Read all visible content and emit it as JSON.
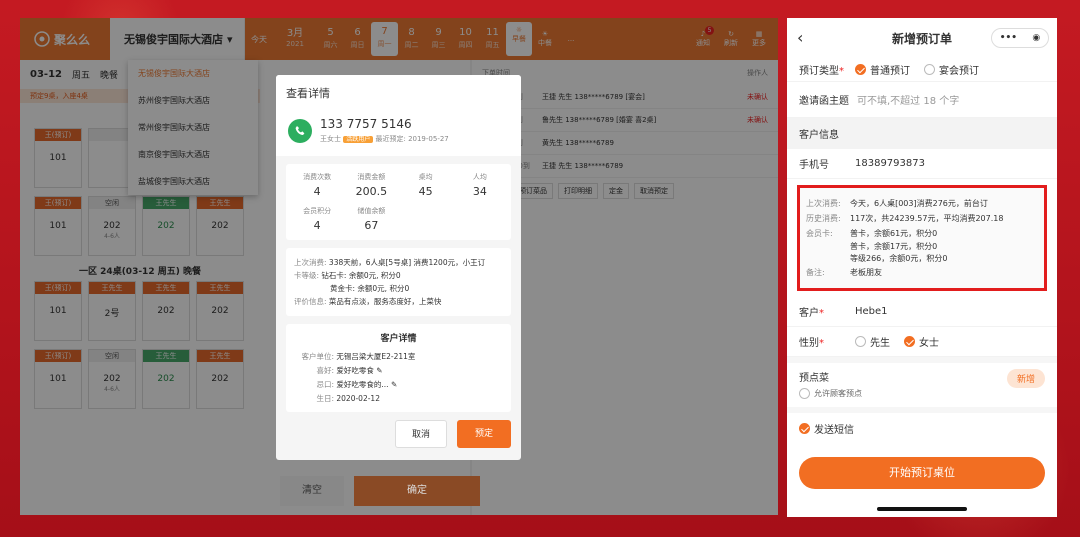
{
  "left": {
    "logo": "聚么么",
    "hotel": "无锡俊宇国际大酒店",
    "today": "今天",
    "month": {
      "label": "3月",
      "year": "2021"
    },
    "days": [
      {
        "d": "5",
        "w": "周六"
      },
      {
        "d": "6",
        "w": "周日"
      },
      {
        "d": "7",
        "w": "周一"
      },
      {
        "d": "8",
        "w": "周二"
      },
      {
        "d": "9",
        "w": "周三"
      },
      {
        "d": "10",
        "w": "周四"
      },
      {
        "d": "11",
        "w": "周五"
      }
    ],
    "meals": [
      "早餐",
      "中餐"
    ],
    "more": "...",
    "top_right": [
      {
        "t": "通知",
        "b": "5"
      },
      {
        "t": "刷新"
      },
      {
        "t": "更多"
      }
    ],
    "date": "03-12",
    "date_sub": "周五",
    "date_tab": "晚餐",
    "warn": "预定9桌，入座4桌",
    "area1": "一区",
    "area2": "一区 24桌(03-12 周五) 晚餐",
    "tables": [
      [
        {
          "h": "王(预订)",
          "n": "101",
          "c": "o"
        },
        {
          "h": "",
          "n": "",
          "c": "w"
        },
        {
          "h": "",
          "n": "",
          "c": "w"
        },
        {
          "h": "王先生",
          "n": "",
          "c": "o"
        }
      ],
      [
        {
          "h": "王(预订)",
          "n": "101",
          "c": "o"
        },
        {
          "h": "空闲",
          "n": "202",
          "s": "4-6人",
          "c": "w"
        },
        {
          "h": "王先生",
          "n": "202",
          "c": "g"
        },
        {
          "h": "王先生",
          "n": "202",
          "c": "o"
        }
      ],
      [
        {
          "h": "王(预订)",
          "n": "101",
          "c": "o"
        },
        {
          "h": "王先生",
          "n": "2号",
          "c": "o"
        },
        {
          "h": "王先生",
          "n": "202",
          "c": "o"
        },
        {
          "h": "王先生",
          "n": "202",
          "c": "o"
        }
      ],
      [
        {
          "h": "王(预订)",
          "n": "101",
          "c": "o"
        },
        {
          "h": "空闲",
          "n": "202",
          "s": "4-6人",
          "c": "w"
        },
        {
          "h": "王先生",
          "n": "202",
          "c": "g"
        },
        {
          "h": "王先生",
          "n": "202",
          "c": "o"
        }
      ]
    ],
    "dropdown": [
      "无锡俊宇国际大酒店",
      "苏州俊宇国际大酒店",
      "常州俊宇国际大酒店",
      "南京俊宇国际大酒店",
      "盐城俊宇国际大酒店"
    ],
    "rp_head": [
      "下单时间",
      "操作人"
    ],
    "reservations": [
      {
        "tm": "7人 18:00到",
        "nm": "王捷 先生 138*****6789 [宴会]",
        "st": "未确认"
      },
      {
        "tm": "8人 18:00到",
        "nm": "鲁先生 138*****6789 [婚宴 喜2桌]",
        "st": "未确认"
      },
      {
        "tm": "5人 18:00到",
        "nm": "黄先生 138*****6789",
        "st": ""
      },
      {
        "tm": "3-5人 18:00到",
        "nm": "王捷 先生 138*****6789",
        "st": ""
      }
    ],
    "actions": [
      "修改",
      "预订菜品",
      "打印明细",
      "定金",
      "取消预定"
    ],
    "clear": "清空",
    "confirm": "确定"
  },
  "modal": {
    "title": "查看详情",
    "phone": "133 7757 5146",
    "name": "王女士",
    "vip": "活跃用户",
    "last": "最近预定: 2019-05-27",
    "stats": [
      {
        "l": "消费次数",
        "v": "4"
      },
      {
        "l": "消费金额",
        "v": "200.5"
      },
      {
        "l": "桌均",
        "v": "45"
      },
      {
        "l": "人均",
        "v": "34"
      },
      {
        "l": "会员积分",
        "v": "4"
      },
      {
        "l": "储值余额",
        "v": "67"
      }
    ],
    "info": [
      {
        "l": "上次消费:",
        "v": "338天前，6人桌[5号桌] 消费1200元，小王订"
      },
      {
        "l": "卡等级:",
        "v": "钻石卡: 余额0元, 积分0"
      },
      {
        "l": "",
        "v": "黄金卡: 余额0元, 积分0"
      },
      {
        "l": "评价信息:",
        "v": "菜品有点淡，服务态度好，上菜快"
      }
    ],
    "cust_title": "客户详情",
    "cust": [
      {
        "l": "客户单位:",
        "v": "无锡吕梁大厦E2-211室"
      },
      {
        "l": "喜好:",
        "v": "爱好吃零食"
      },
      {
        "l": "忌口:",
        "v": "爱好吃零食的..."
      },
      {
        "l": "生日:",
        "v": "2020-02-12"
      }
    ],
    "cancel": "取消",
    "ok": "预定"
  },
  "phone": {
    "title": "新增预订单",
    "back": "‹",
    "type_label": "预订类型",
    "types": [
      "普通预订",
      "宴会预订"
    ],
    "invite_label": "邀请函主题",
    "invite_ph": "可不填,不超过 18 个字",
    "cust_section": "客户信息",
    "mobile_label": "手机号",
    "mobile": "18389793873",
    "history": [
      {
        "l": "上次消费:",
        "v": "今天，6人桌[003]消费276元，前台订"
      },
      {
        "l": "历史消费:",
        "v": "117次，共24239.57元，平均消费207.18"
      },
      {
        "l": "会员卡:",
        "v": "普卡，余额61元，积分0"
      },
      {
        "l": "",
        "v": "普卡，余额17元，积分0"
      },
      {
        "l": "",
        "v": "等级266，余额0元，积分0"
      },
      {
        "l": "备注:",
        "v": "老板朋友"
      }
    ],
    "cust_label": "客户",
    "cust_value": "Hebe1",
    "gender_label": "性别",
    "genders": [
      "先生",
      "女士"
    ],
    "dish_section": "预点菜",
    "dish_opt": "允许顾客预点",
    "new_btn": "新增",
    "sms": "发送短信",
    "start": "开始预订桌位"
  }
}
